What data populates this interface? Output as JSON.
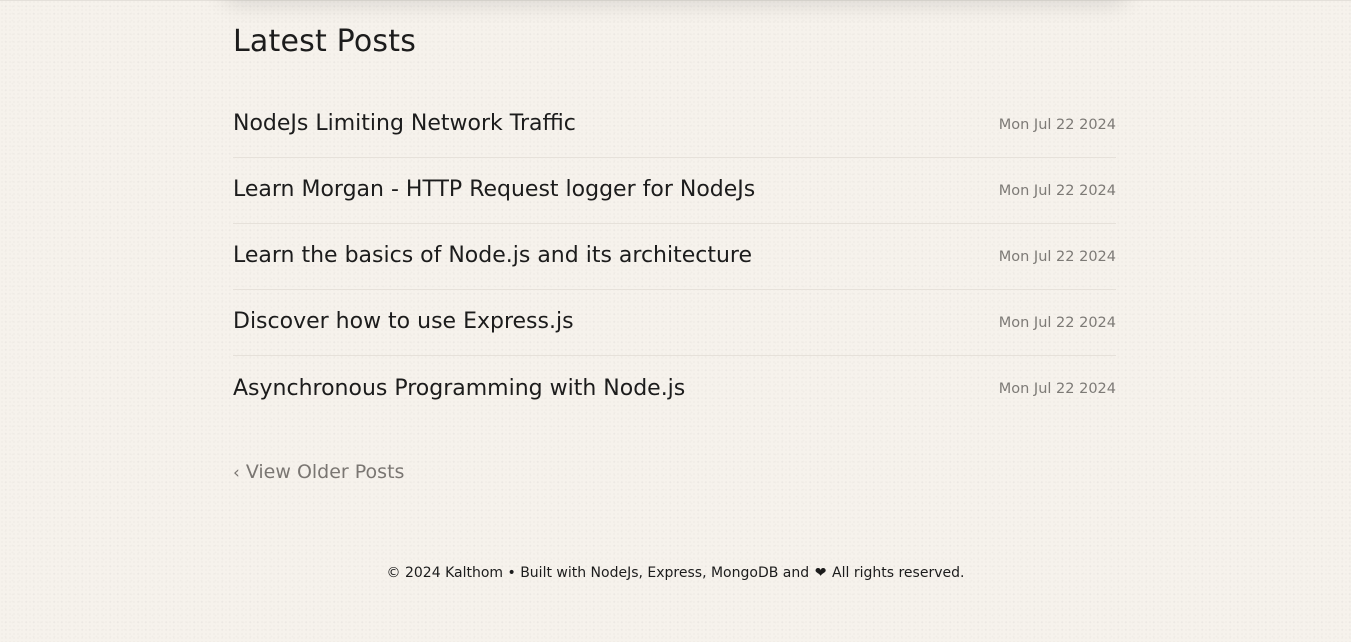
{
  "page": {
    "heading": "Latest Posts"
  },
  "posts": [
    {
      "title": "NodeJs Limiting Network Traffic",
      "date": "Mon Jul 22 2024"
    },
    {
      "title": "Learn Morgan - HTTP Request logger for NodeJs",
      "date": "Mon Jul 22 2024"
    },
    {
      "title": "Learn the basics of Node.js and its architecture",
      "date": "Mon Jul 22 2024"
    },
    {
      "title": "Discover how to use Express.js",
      "date": "Mon Jul 22 2024"
    },
    {
      "title": "Asynchronous Programming with Node.js",
      "date": "Mon Jul 22 2024"
    }
  ],
  "pagination": {
    "chevron": "‹",
    "older_label": "View Older Posts"
  },
  "footer": {
    "text_before": "© 2024 Kalthom • Built with NodeJs, Express, MongoDB and",
    "heart": "❤",
    "text_after": "All rights reserved."
  },
  "icons": {
    "chevron": "chevron-left-icon",
    "heart": "heart-icon"
  },
  "colors": {
    "background": "#f6f2ec",
    "text": "#1c1c1c",
    "muted": "#7d7a76",
    "divider": "#e6e1da"
  }
}
